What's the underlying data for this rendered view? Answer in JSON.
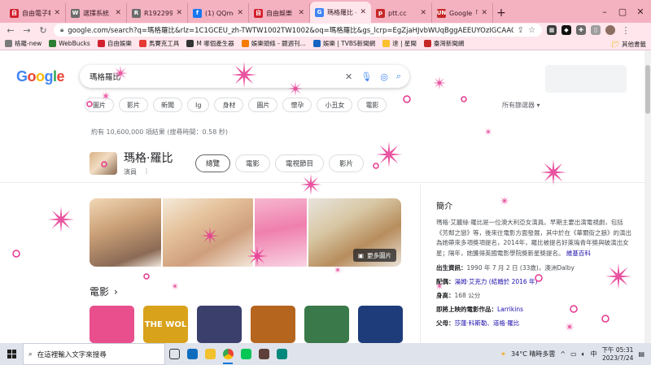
{
  "browser": {
    "tabs": [
      {
        "title": "自由電子報",
        "favicon_color": "#d3202e",
        "favicon_glyph": "自"
      },
      {
        "title": "選擇系統 W",
        "favicon_color": "#6b6b6b",
        "favicon_glyph": "W"
      },
      {
        "title": "R19229956",
        "favicon_color": "#6b6b6b",
        "favicon_glyph": "R"
      },
      {
        "title": "(1) QQmei",
        "favicon_color": "#1877f2",
        "favicon_glyph": "f"
      },
      {
        "title": "自由娛樂",
        "favicon_color": "#d3202e",
        "favicon_glyph": "自"
      },
      {
        "title": "瑪格羅比 - G",
        "favicon_color": "#4285f4",
        "favicon_glyph": "G",
        "active": true
      },
      {
        "title": "ptt.cc",
        "favicon_color": "#c62828",
        "favicon_glyph": "p"
      },
      {
        "title": "Google「若",
        "favicon_color": "#c62828",
        "favicon_glyph": "UN"
      }
    ],
    "new_tab": "+",
    "url": "google.com/search?q=瑪格羅比&rlz=1C1GCEU_zh-TWTW1002TW1002&oq=瑪格羅比&gs_lcrp=EgZjaHJvbWUqBggAEEUYOzIGCAAQRRg7...",
    "bookmarks": [
      {
        "label": "格羅-new",
        "color": "#7a7a7a"
      },
      {
        "label": "WebBucks",
        "color": "#2e7d32"
      },
      {
        "label": "自由娛樂",
        "color": "#d3202e"
      },
      {
        "label": "馬賽克工具",
        "color": "#e53935"
      },
      {
        "label": "M 哪個產生器",
        "color": "#333333"
      },
      {
        "label": "娛樂頭條 - 鏡週刊...",
        "color": "#f57c00"
      },
      {
        "label": "娛樂 | TVBS新聞網",
        "color": "#1565c0"
      },
      {
        "label": "達 | 星聞",
        "color": "#fbc02d"
      },
      {
        "label": "臺灣新聞網",
        "color": "#c62828"
      }
    ],
    "bookmarks_other": "其他書籤"
  },
  "google": {
    "logo": "Google",
    "logo_colors": [
      "#4285f4",
      "#ea4335",
      "#fbbc05",
      "#4285f4",
      "#34a853",
      "#ea4335"
    ],
    "query": "瑪格羅比",
    "chips": [
      "圖片",
      "影片",
      "新聞",
      "Ig",
      "身材",
      "圖片",
      "懷孕",
      "小丑女",
      "電影"
    ],
    "filters_label": "所有篩選器 ▾",
    "results_stats": "約有 10,600,000 項結果 (搜尋時間：0.58 秒)",
    "entity": {
      "name": "瑪格·羅比",
      "subtitle": "演員",
      "tabs": [
        "總覽",
        "電影",
        "電視節目",
        "影片"
      ]
    },
    "more_images": "更多圖片",
    "movies_heading": "電影",
    "movies": [
      {
        "label": "",
        "color": "#e94f8c"
      },
      {
        "label": "THE WOL",
        "color": "#d9a21b"
      },
      {
        "label": "",
        "color": "#3b3f6b"
      },
      {
        "label": "",
        "color": "#b5651d"
      },
      {
        "label": "",
        "color": "#3a7a4a"
      },
      {
        "label": "",
        "color": "#1f3c7a"
      }
    ],
    "knowledge_panel": {
      "heading": "簡介",
      "description": "瑪格·艾麗絲·羅比是一位澳大利亞女演員。早期主要出演電視劇，包括《芳鄰之戀》等，後來往電影方面發展，其中於在《華爾街之狼》的演出為她帶來多項獎項提名，2014年，羅比被提名好萊塢青年獎與破演出女星；隔年，她獲得英國電影學院獎新星獎提名。",
      "wiki": "維基百科",
      "born_label": "出生資訊：",
      "born_value": "1990 年 7 月 2 日 (33歲)，澳洲Dalby",
      "spouse_label": "配偶：",
      "spouse_value": "湯姆·艾克力 (結婚於 2016 年)",
      "height_label": "身高：",
      "height_value": "168 公分",
      "upcoming_label": "即將上映的電影作品：",
      "upcoming_value": "Larrikins",
      "parents_label": "父母：",
      "parents_value": "莎蓮·科斯勒、道格·羅比"
    }
  },
  "taskbar": {
    "search_placeholder": "在這裡輸入文字來搜尋",
    "weather": "34°C 晴時多雲",
    "time": "下午 05:31",
    "date": "2023/7/24",
    "ime": "中"
  }
}
